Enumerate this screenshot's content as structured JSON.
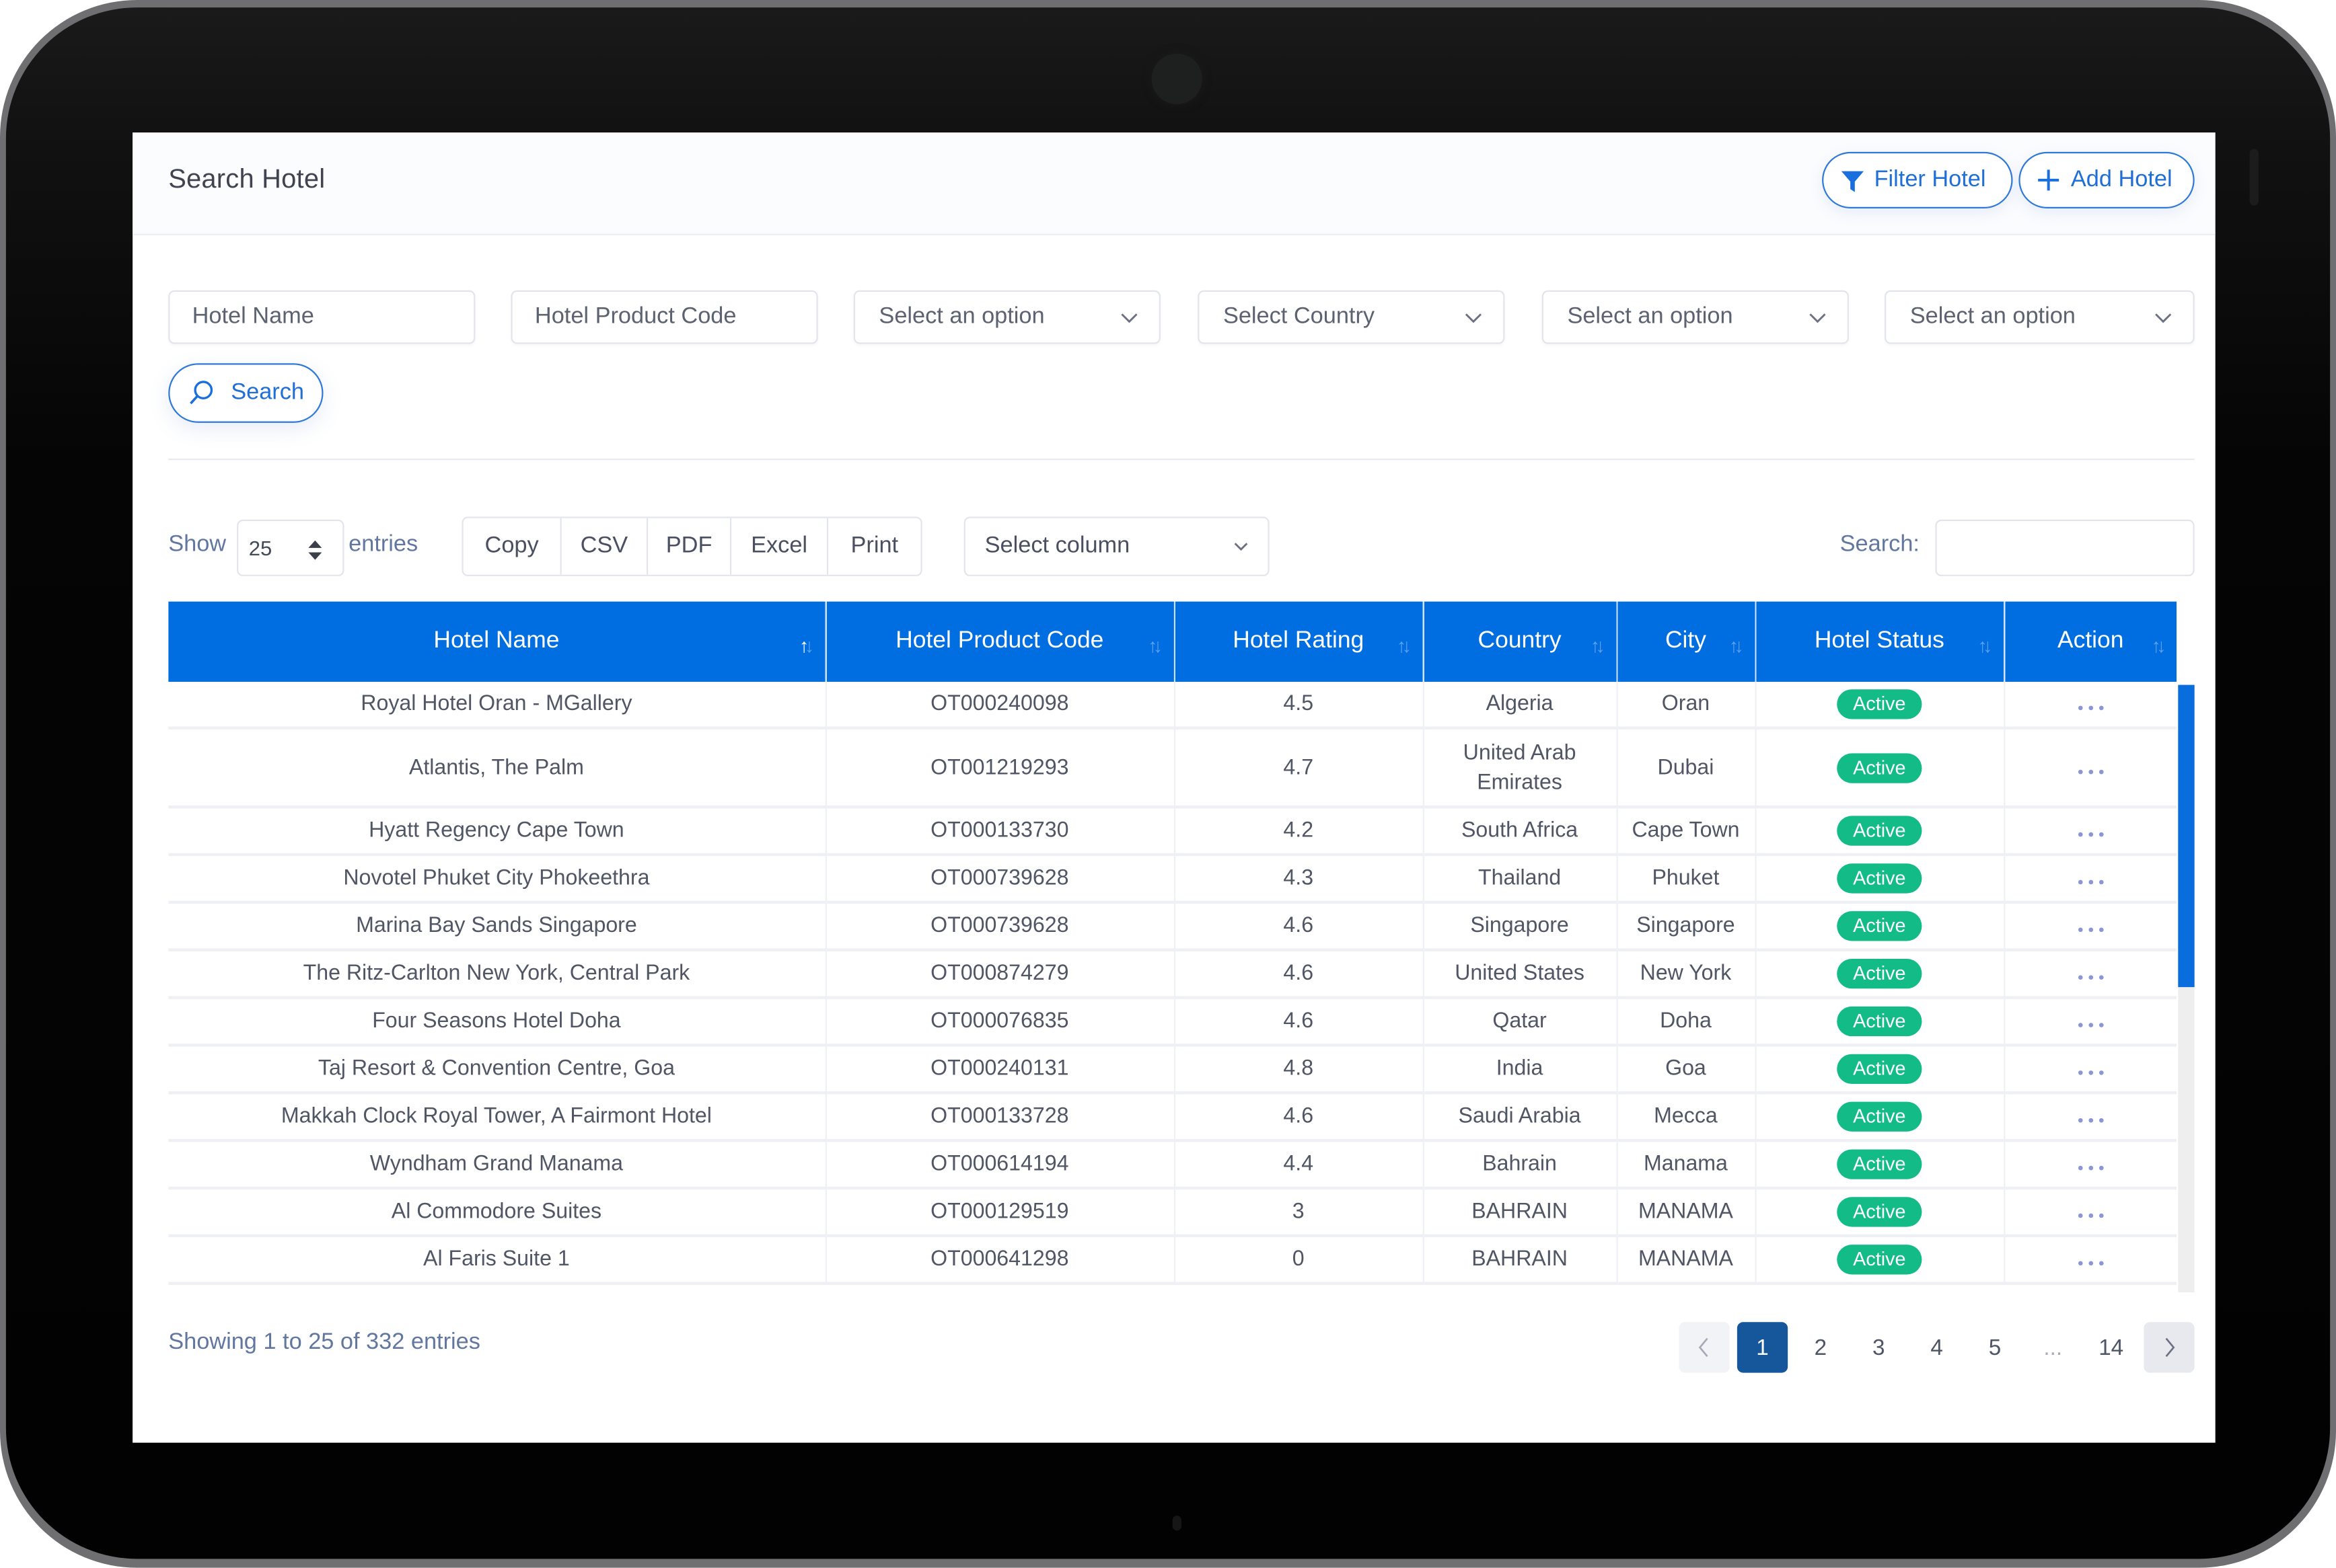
{
  "header": {
    "title": "Search Hotel",
    "filter_button": "Filter Hotel",
    "add_button": "Add Hotel"
  },
  "filters": {
    "hotel_name_placeholder": "Hotel Name",
    "product_code_placeholder": "Hotel Product Code",
    "select_1": "Select an option",
    "select_country": "Select Country",
    "select_3": "Select an option",
    "select_4": "Select an option",
    "search_button": "Search"
  },
  "toolbar": {
    "show_label": "Show",
    "entries_value": "25",
    "entries_label": "entries",
    "export_buttons": [
      "Copy",
      "CSV",
      "PDF",
      "Excel",
      "Print"
    ],
    "column_select": "Select column",
    "search_label": "Search:",
    "search_value": ""
  },
  "table": {
    "columns": [
      "Hotel Name",
      "Hotel Product Code",
      "Hotel Rating",
      "Country",
      "City",
      "Hotel Status",
      "Action"
    ],
    "sorted_column": "Hotel Name",
    "sort_direction": "ascending",
    "rows": [
      {
        "name": "Royal Hotel Oran - MGallery",
        "code": "OT000240098",
        "rating": "4.5",
        "country": "Algeria",
        "city": "Oran",
        "status": "Active"
      },
      {
        "name": "Atlantis, The Palm",
        "code": "OT001219293",
        "rating": "4.7",
        "country": "United Arab Emirates",
        "city": "Dubai",
        "status": "Active"
      },
      {
        "name": "Hyatt Regency Cape Town",
        "code": "OT000133730",
        "rating": "4.2",
        "country": "South Africa",
        "city": "Cape Town",
        "status": "Active"
      },
      {
        "name": "Novotel Phuket City Phokeethra",
        "code": "OT000739628",
        "rating": "4.3",
        "country": "Thailand",
        "city": "Phuket",
        "status": "Active"
      },
      {
        "name": "Marina Bay Sands Singapore",
        "code": "OT000739628",
        "rating": "4.6",
        "country": "Singapore",
        "city": "Singapore",
        "status": "Active"
      },
      {
        "name": "The Ritz-Carlton New York, Central Park",
        "code": "OT000874279",
        "rating": "4.6",
        "country": "United States",
        "city": "New York",
        "status": "Active"
      },
      {
        "name": "Four Seasons Hotel Doha",
        "code": "OT000076835",
        "rating": "4.6",
        "country": "Qatar",
        "city": "Doha",
        "status": "Active"
      },
      {
        "name": "Taj Resort & Convention Centre, Goa",
        "code": "OT000240131",
        "rating": "4.8",
        "country": "India",
        "city": "Goa",
        "status": "Active"
      },
      {
        "name": "Makkah Clock Royal Tower, A Fairmont Hotel",
        "code": "OT000133728",
        "rating": "4.6",
        "country": "Saudi Arabia",
        "city": "Mecca",
        "status": "Active"
      },
      {
        "name": "Wyndham Grand Manama",
        "code": "OT000614194",
        "rating": "4.4",
        "country": "Bahrain",
        "city": "Manama",
        "status": "Active"
      },
      {
        "name": "Al Commodore Suites",
        "code": "OT000129519",
        "rating": "3",
        "country": "BAHRAIN",
        "city": "MANAMA",
        "status": "Active"
      },
      {
        "name": "Al Faris Suite 1",
        "code": "OT000641298",
        "rating": "0",
        "country": "BAHRAIN",
        "city": "MANAMA",
        "status": "Active"
      }
    ]
  },
  "footer": {
    "info": "Showing 1 to 25 of 332 entries",
    "pages": [
      "1",
      "2",
      "3",
      "4",
      "5",
      "...",
      "14"
    ],
    "current_page": "1",
    "prev_icon": "chevron-left",
    "next_icon": "chevron-right"
  },
  "colors": {
    "accent": "#006de0",
    "status_active": "#13bb87",
    "pager_active": "#15579a"
  }
}
